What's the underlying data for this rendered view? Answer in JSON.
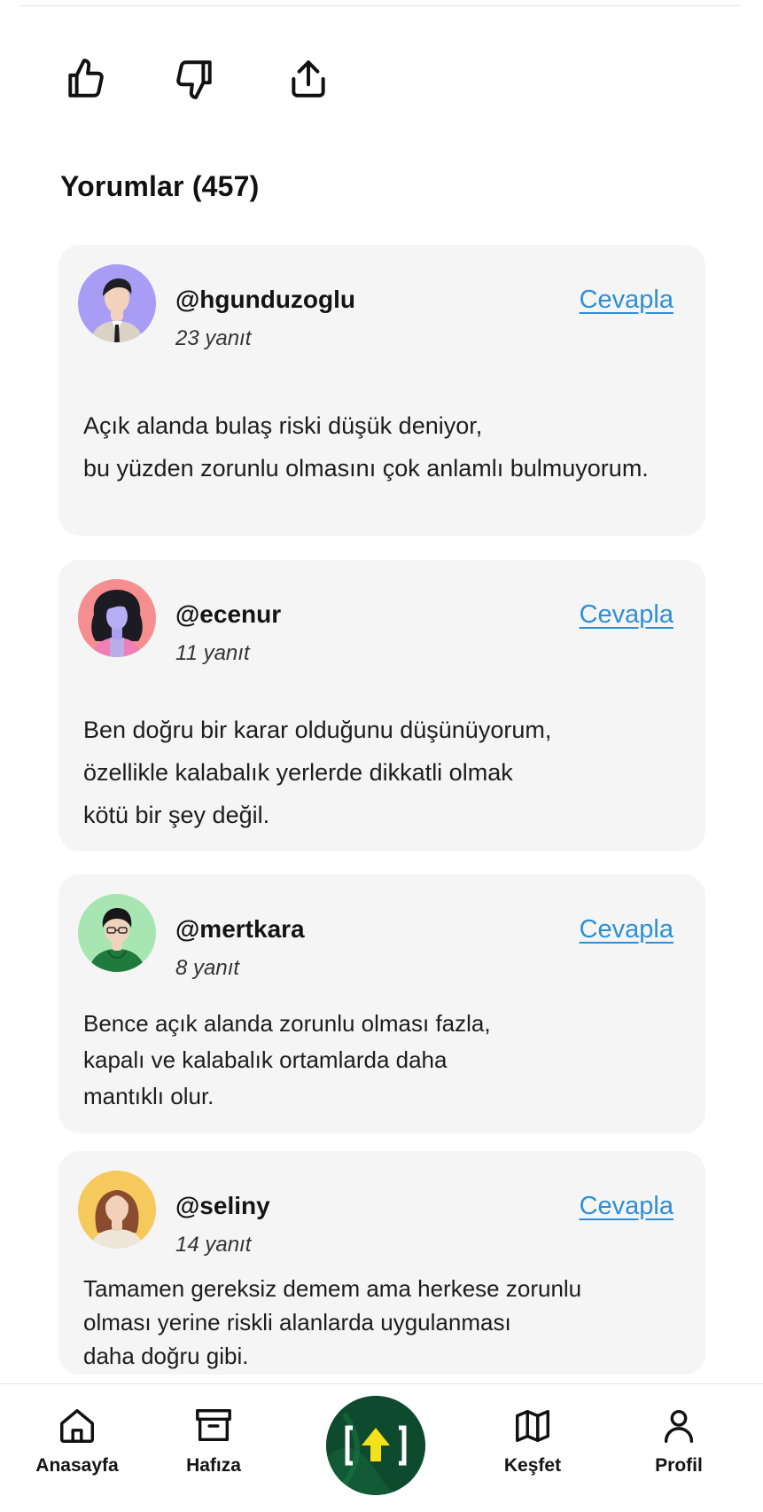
{
  "actions": {
    "like_icon": "thumbs-up-icon",
    "dislike_icon": "thumbs-down-icon",
    "share_icon": "share-icon"
  },
  "comments_section": {
    "title": "Yorumlar",
    "count": "(457)"
  },
  "comments": [
    {
      "username": "@hgunduzoglu",
      "replies": "23 yanıt",
      "reply_label": "Cevapla",
      "lines": [
        "Açık alanda bulaş riski düşük deniyor,",
        "bu yüzden zorunlu olmasını çok anlamlı bulmuyorum."
      ],
      "avatar_bg": "#a99cf5"
    },
    {
      "username": "@ecenur",
      "replies": "11 yanıt",
      "reply_label": "Cevapla",
      "lines": [
        "Ben doğru bir karar olduğunu düşünüyorum,",
        "özellikle kalabalık yerlerde dikkatli olmak",
        "kötü bir şey değil."
      ],
      "avatar_bg": "#f58e8e"
    },
    {
      "username": "@mertkara",
      "replies": "8 yanıt",
      "reply_label": "Cevapla",
      "lines": [
        "Bence açık alanda zorunlu olması fazla,",
        "kapalı ve kalabalık ortamlarda daha",
        "mantıklı olur."
      ],
      "avatar_bg": "#a7e5b3"
    },
    {
      "username": "@seliny",
      "replies": "14 yanıt",
      "reply_label": "Cevapla",
      "lines": [
        "Tamamen gereksiz demem ama herkese zorunlu",
        "olması yerine riskli alanlarda uygulanması",
        "daha doğru gibi."
      ],
      "avatar_bg": "#f6c95c"
    }
  ],
  "bottom_nav": {
    "items": [
      {
        "label": "Anasayfa",
        "icon": "home-icon"
      },
      {
        "label": "Hafıza",
        "icon": "archive-box-icon"
      },
      {
        "label": "Keşfet",
        "icon": "map-icon"
      },
      {
        "label": "Profil",
        "icon": "user-icon"
      }
    ],
    "center_icon": "upload-arrow-icon"
  },
  "colors": {
    "accent_link": "#2f8fd6",
    "card_bg": "#f5f5f5",
    "center_button_bg": "#0e4a2d",
    "center_arrow": "#f5e11b"
  }
}
